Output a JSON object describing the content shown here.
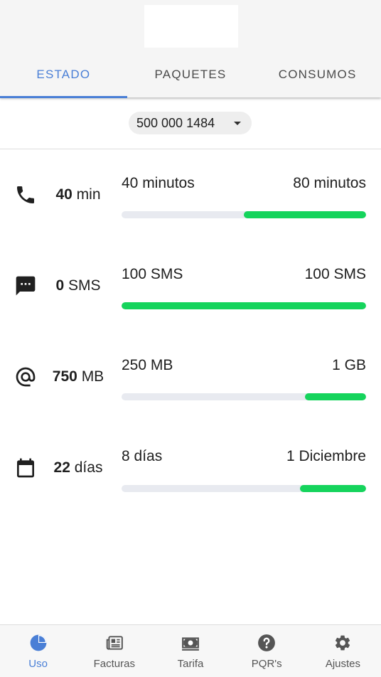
{
  "header": {
    "logo": "logo-placeholder",
    "tabs": [
      {
        "label": "ESTADO",
        "active": true
      },
      {
        "label": "PAQUETES",
        "active": false
      },
      {
        "label": "CONSUMOS",
        "active": false
      }
    ]
  },
  "line_selector": {
    "number": "500 000 1484",
    "icon": "caret-down-icon"
  },
  "usage": [
    {
      "icon": "phone-icon",
      "amount": "40",
      "unit": "min",
      "left_label": "40 minutos",
      "right_label": "80 minutos",
      "remaining_fraction": 0.5
    },
    {
      "icon": "sms-icon",
      "amount": "0",
      "unit": "SMS",
      "left_label": "100 SMS",
      "right_label": "100 SMS",
      "remaining_fraction": 1.0
    },
    {
      "icon": "at-icon",
      "amount": "750",
      "unit": "MB",
      "left_label": "250 MB",
      "right_label": "1 GB",
      "remaining_fraction": 0.25
    },
    {
      "icon": "calendar-icon",
      "amount": "22",
      "unit": "días",
      "left_label": "8 días",
      "right_label": "1 Diciembre",
      "remaining_fraction": 0.27
    }
  ],
  "colors": {
    "accent": "#4a7fd6",
    "progress_fill": "#15d45c",
    "progress_track": "#e8eaf0"
  },
  "bottom_nav": [
    {
      "label": "Uso",
      "icon": "pie-chart-icon",
      "active": true
    },
    {
      "label": "Facturas",
      "icon": "newspaper-icon",
      "active": false
    },
    {
      "label": "Tarifa",
      "icon": "money-icon",
      "active": false
    },
    {
      "label": "PQR's",
      "icon": "help-icon",
      "active": false
    },
    {
      "label": "Ajustes",
      "icon": "gear-icon",
      "active": false
    }
  ]
}
